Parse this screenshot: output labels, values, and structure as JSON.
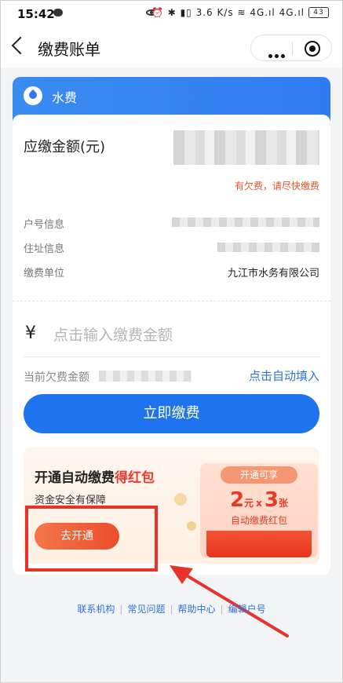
{
  "status_bar": {
    "time": "15:42",
    "right_text": "⏰ ✱ ▮▯ 3.6 K/s ≋ 4G.ıl 4G.ıl",
    "battery": "43"
  },
  "header": {
    "title": "缴费账单"
  },
  "bill": {
    "category": "水费",
    "due_label": "应缴金额(元)",
    "owe_notice": "有欠费，请尽快缴费",
    "rows": [
      {
        "label": "户号信息"
      },
      {
        "label": "住址信息"
      },
      {
        "label": "缴费单位",
        "value": "九江市水务有限公司"
      }
    ]
  },
  "payment": {
    "currency_symbol": "¥",
    "placeholder": "点击输入缴费金额",
    "current_owe_label": "当前欠费金额",
    "autofill_label": "点击自动填入",
    "pay_button": "立即缴费"
  },
  "promo": {
    "title_main": "开通自动缴费",
    "title_red": "得红包",
    "subtitle": "资金安全有保障",
    "open_button": "去开通",
    "tag": "开通可享",
    "amount": "2",
    "amount_unit": "元",
    "times_sign": "x",
    "count": "3",
    "count_unit": "张",
    "packet_label": "自动缴费红包"
  },
  "footer": {
    "links": [
      "联系机构",
      "常见问题",
      "帮助中心",
      "编辑户号"
    ]
  },
  "colors": {
    "accent_blue": "#1f73ee",
    "warning_red": "#e5532a",
    "highlight_red": "#e9322a"
  }
}
